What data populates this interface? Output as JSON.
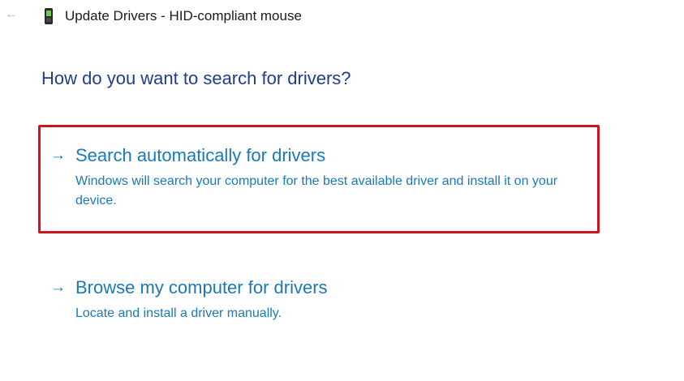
{
  "window": {
    "title": "Update Drivers - HID-compliant mouse",
    "back_icon": "back-arrow-icon",
    "device_icon": "mouse-device-icon"
  },
  "main": {
    "heading": "How do you want to search for drivers?",
    "options": [
      {
        "icon": "arrow-right-icon",
        "arrow_glyph": "→",
        "title": "Search automatically for drivers",
        "description": "Windows will search your computer for the best available driver and install it on your device.",
        "highlighted": true
      },
      {
        "icon": "arrow-right-icon",
        "arrow_glyph": "→",
        "title": "Browse my computer for drivers",
        "description": "Locate and install a driver manually.",
        "highlighted": false
      }
    ]
  },
  "colors": {
    "heading": "#1f3d8a",
    "link": "#1a79b8",
    "highlight_border": "#cf1420",
    "title_text": "#1a1a1a"
  }
}
